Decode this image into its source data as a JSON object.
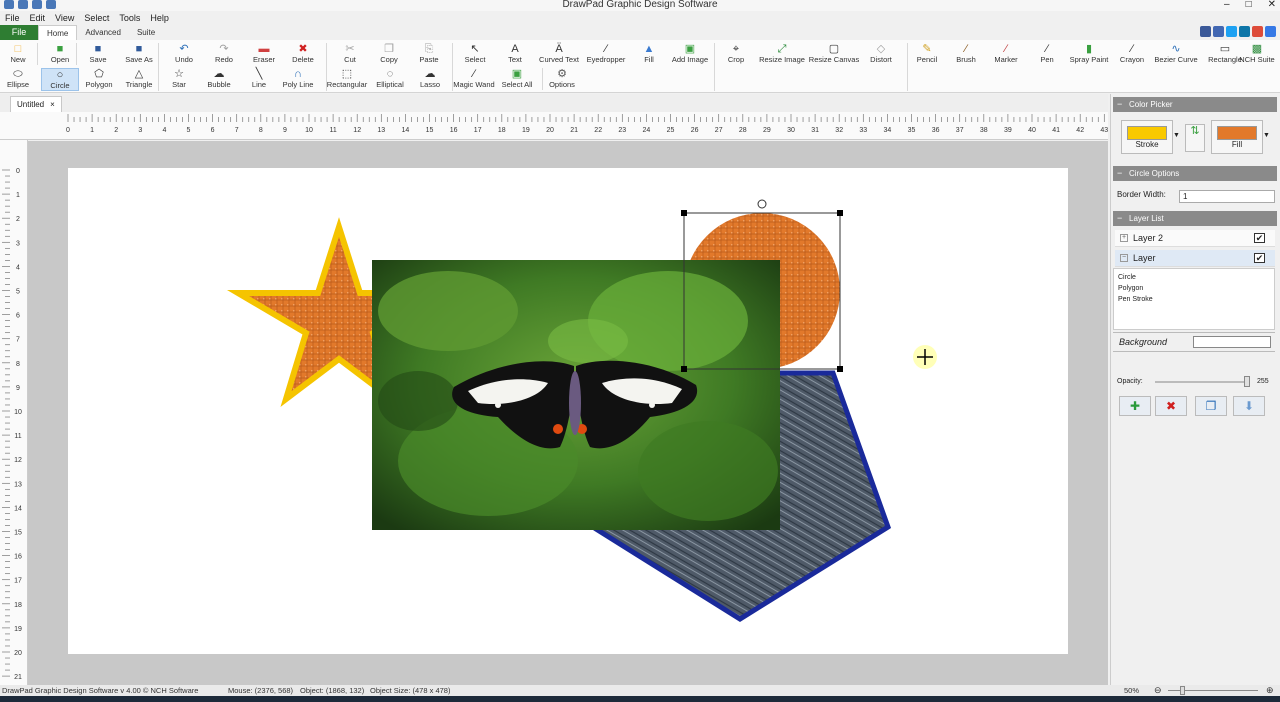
{
  "window": {
    "title": "DrawPad Graphic Design Software",
    "min": "–",
    "max": "□",
    "close": "✕"
  },
  "menu": [
    "File",
    "Edit",
    "View",
    "Select",
    "Tools",
    "Help"
  ],
  "tabs": {
    "file": "File",
    "home": "Home",
    "advanced": "Advanced",
    "suite": "Suite"
  },
  "social_colors": [
    "#3b5998",
    "#4267b2",
    "#1da1f2",
    "#0e76a8",
    "#dd4b39",
    "#3578e5"
  ],
  "ribbon": {
    "row1": [
      {
        "name": "new",
        "label": "New",
        "icon": "□",
        "color": "#f2b94a"
      },
      {
        "name": "open",
        "label": "Open",
        "icon": "■",
        "color": "#3aa040"
      },
      {
        "name": "save",
        "label": "Save",
        "icon": "■",
        "color": "#305a9a"
      },
      {
        "name": "save-as",
        "label": "Save As",
        "icon": "■",
        "color": "#305a9a"
      },
      {
        "name": "undo",
        "label": "Undo",
        "icon": "↶",
        "color": "#2c6fb8"
      },
      {
        "name": "redo",
        "label": "Redo",
        "icon": "↷",
        "color": "#a0a0a0"
      },
      {
        "name": "eraser",
        "label": "Eraser",
        "icon": "▬",
        "color": "#d04040"
      },
      {
        "name": "delete",
        "label": "Delete",
        "icon": "✖",
        "color": "#d02020"
      },
      {
        "name": "cut",
        "label": "Cut",
        "icon": "✂",
        "color": "#a0a0a0"
      },
      {
        "name": "copy",
        "label": "Copy",
        "icon": "❐",
        "color": "#a0a0a0"
      },
      {
        "name": "paste",
        "label": "Paste",
        "icon": "⎘",
        "color": "#a0a0a0"
      },
      {
        "name": "select",
        "label": "Select",
        "icon": "↖",
        "color": "#333"
      },
      {
        "name": "text",
        "label": "Text",
        "icon": "A",
        "color": "#333"
      },
      {
        "name": "curved-text",
        "label": "Curved Text",
        "icon": "Ä",
        "color": "#333"
      },
      {
        "name": "eyedropper",
        "label": "Eyedropper",
        "icon": "∕",
        "color": "#333"
      },
      {
        "name": "fill",
        "label": "Fill",
        "icon": "▲",
        "color": "#3a7ad0"
      },
      {
        "name": "add-image",
        "label": "Add Image",
        "icon": "▣",
        "color": "#3aa040"
      },
      {
        "name": "crop",
        "label": "Crop",
        "icon": "⌖",
        "color": "#333"
      },
      {
        "name": "resize-image",
        "label": "Resize Image",
        "icon": "⤢",
        "color": "#2a8a3a"
      },
      {
        "name": "resize-canvas",
        "label": "Resize Canvas",
        "icon": "▢",
        "color": "#333"
      },
      {
        "name": "distort",
        "label": "Distort",
        "icon": "◇",
        "color": "#a0a0a0"
      },
      {
        "name": "pencil",
        "label": "Pencil",
        "icon": "✎",
        "color": "#d0a020"
      },
      {
        "name": "brush",
        "label": "Brush",
        "icon": "∕",
        "color": "#8a5a20"
      },
      {
        "name": "marker",
        "label": "Marker",
        "icon": "∕",
        "color": "#c04040"
      },
      {
        "name": "pen",
        "label": "Pen",
        "icon": "∕",
        "color": "#333"
      },
      {
        "name": "spray-paint",
        "label": "Spray Paint",
        "icon": "▮",
        "color": "#3aa040"
      },
      {
        "name": "crayon",
        "label": "Crayon",
        "icon": "∕",
        "color": "#333"
      },
      {
        "name": "bezier-curve",
        "label": "Bezier Curve",
        "icon": "∿",
        "color": "#2c6fb8"
      },
      {
        "name": "rectangle",
        "label": "Rectangle",
        "icon": "▭",
        "color": "#333"
      },
      {
        "name": "nch-suite",
        "label": "NCH Suite",
        "icon": "▩",
        "color": "#2a8a3a"
      }
    ],
    "row2": [
      {
        "name": "ellipse",
        "label": "Ellipse",
        "icon": "⬭",
        "color": "#333"
      },
      {
        "name": "circle",
        "label": "Circle",
        "icon": "○",
        "color": "#333"
      },
      {
        "name": "polygon",
        "label": "Polygon",
        "icon": "⬠",
        "color": "#333"
      },
      {
        "name": "triangle",
        "label": "Triangle",
        "icon": "△",
        "color": "#333"
      },
      {
        "name": "star",
        "label": "Star",
        "icon": "☆",
        "color": "#333"
      },
      {
        "name": "bubble",
        "label": "Bubble",
        "icon": "☁",
        "color": "#333"
      },
      {
        "name": "line",
        "label": "Line",
        "icon": "╲",
        "color": "#333"
      },
      {
        "name": "poly-line",
        "label": "Poly Line",
        "icon": "∩",
        "color": "#2c6fb8"
      },
      {
        "name": "rectangular",
        "label": "Rectangular",
        "icon": "⬚",
        "color": "#333"
      },
      {
        "name": "elliptical",
        "label": "Elliptical",
        "icon": "◌",
        "color": "#333"
      },
      {
        "name": "lasso",
        "label": "Lasso",
        "icon": "☁",
        "color": "#333"
      },
      {
        "name": "magic-wand",
        "label": "Magic Wand",
        "icon": "∕",
        "color": "#333"
      },
      {
        "name": "select-all",
        "label": "Select All",
        "icon": "▣",
        "color": "#3aa040"
      },
      {
        "name": "options",
        "label": "Options",
        "icon": "⚙",
        "color": "#555"
      }
    ]
  },
  "document": {
    "tab": "Untitled",
    "close": "×"
  },
  "ruler": {
    "h_labels": [
      "0",
      "1",
      "2",
      "3",
      "4",
      "5",
      "6",
      "7",
      "8",
      "9",
      "10",
      "11",
      "12",
      "13",
      "14",
      "15",
      "16",
      "17",
      "18",
      "19",
      "20",
      "21",
      "22",
      "23",
      "24",
      "25",
      "26",
      "27",
      "28",
      "29",
      "30",
      "31",
      "32",
      "33",
      "34",
      "35",
      "36",
      "37",
      "38",
      "39",
      "40",
      "41",
      "42",
      "43"
    ],
    "v_labels": [
      "0",
      "1",
      "2",
      "3",
      "4",
      "5",
      "6",
      "7",
      "8",
      "9",
      "10",
      "11",
      "12",
      "13",
      "14",
      "15",
      "16",
      "17",
      "18",
      "19",
      "20",
      "21"
    ]
  },
  "panel": {
    "color_picker": {
      "title": "Color Picker",
      "stroke_label": "Stroke",
      "stroke_color": "#f9c900",
      "fill_label": "Fill",
      "fill_color": "#e2792b"
    },
    "circle_options": {
      "title": "Circle Options",
      "border_label": "Border Width:",
      "border_value": "1"
    },
    "layer_list": {
      "title": "Layer List",
      "layers": [
        {
          "name": "Layer 2",
          "expanded": false
        },
        {
          "name": "Layer",
          "expanded": true
        }
      ],
      "items": [
        "Circle",
        "Polygon",
        "Pen Stroke"
      ],
      "background_label": "Background"
    },
    "opacity": {
      "label": "Opacity:",
      "value": "255"
    }
  },
  "canvas_colors": {
    "star_fill": "#e2792b",
    "star_stroke": "#f5c400",
    "circle_fill": "#e2792b",
    "polygon_fill": "#4f5a68",
    "polygon_stroke": "#1a2a9a"
  },
  "status": {
    "app": "DrawPad Graphic Design Software v 4.00 © NCH Software",
    "mouse": "Mouse: (2376, 568)",
    "object": "Object: (1868, 132)",
    "object_size": "Object Size: (478 x 478)",
    "zoom": "50%"
  }
}
